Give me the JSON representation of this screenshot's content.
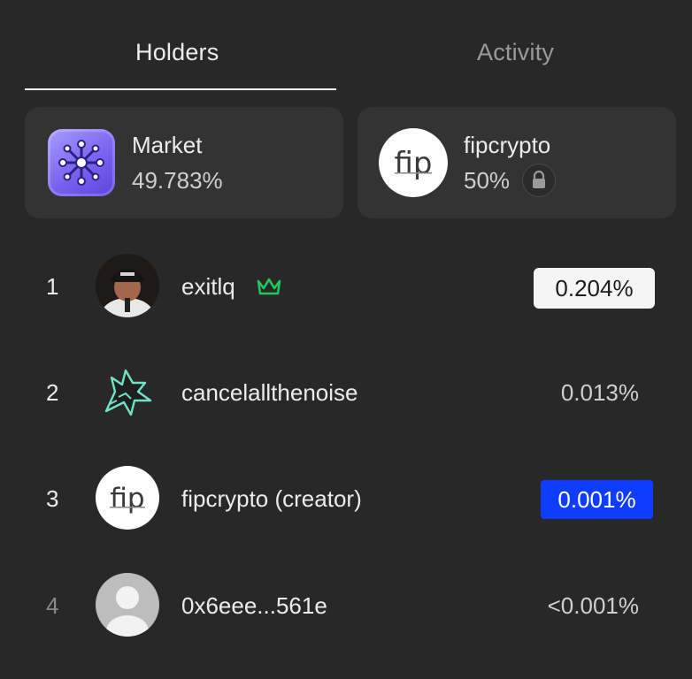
{
  "tabs": [
    {
      "label": "Holders",
      "active": true
    },
    {
      "label": "Activity",
      "active": false
    }
  ],
  "summary": {
    "market": {
      "title": "Market",
      "percent": "49.783%"
    },
    "creator": {
      "title": "fipcrypto",
      "percent": "50%",
      "locked": true
    }
  },
  "holders": [
    {
      "rank": "1",
      "name": "exitlq",
      "percent": "0.204%",
      "badge": "crown-icon",
      "highlight": "white"
    },
    {
      "rank": "2",
      "name": "cancelallthenoise",
      "percent": "0.013%",
      "highlight": "none"
    },
    {
      "rank": "3",
      "name": "fipcrypto (creator)",
      "percent": "0.001%",
      "highlight": "blue"
    },
    {
      "rank": "4",
      "name": "0x6eee...561e",
      "percent": "<0.001%",
      "highlight": "none"
    }
  ],
  "logo_text": "fip",
  "colors": {
    "background": "#282828",
    "card": "#333333",
    "accent_blue": "#0f3dff",
    "crown_green": "#22c55e",
    "market_purple": "#7a63f0"
  }
}
